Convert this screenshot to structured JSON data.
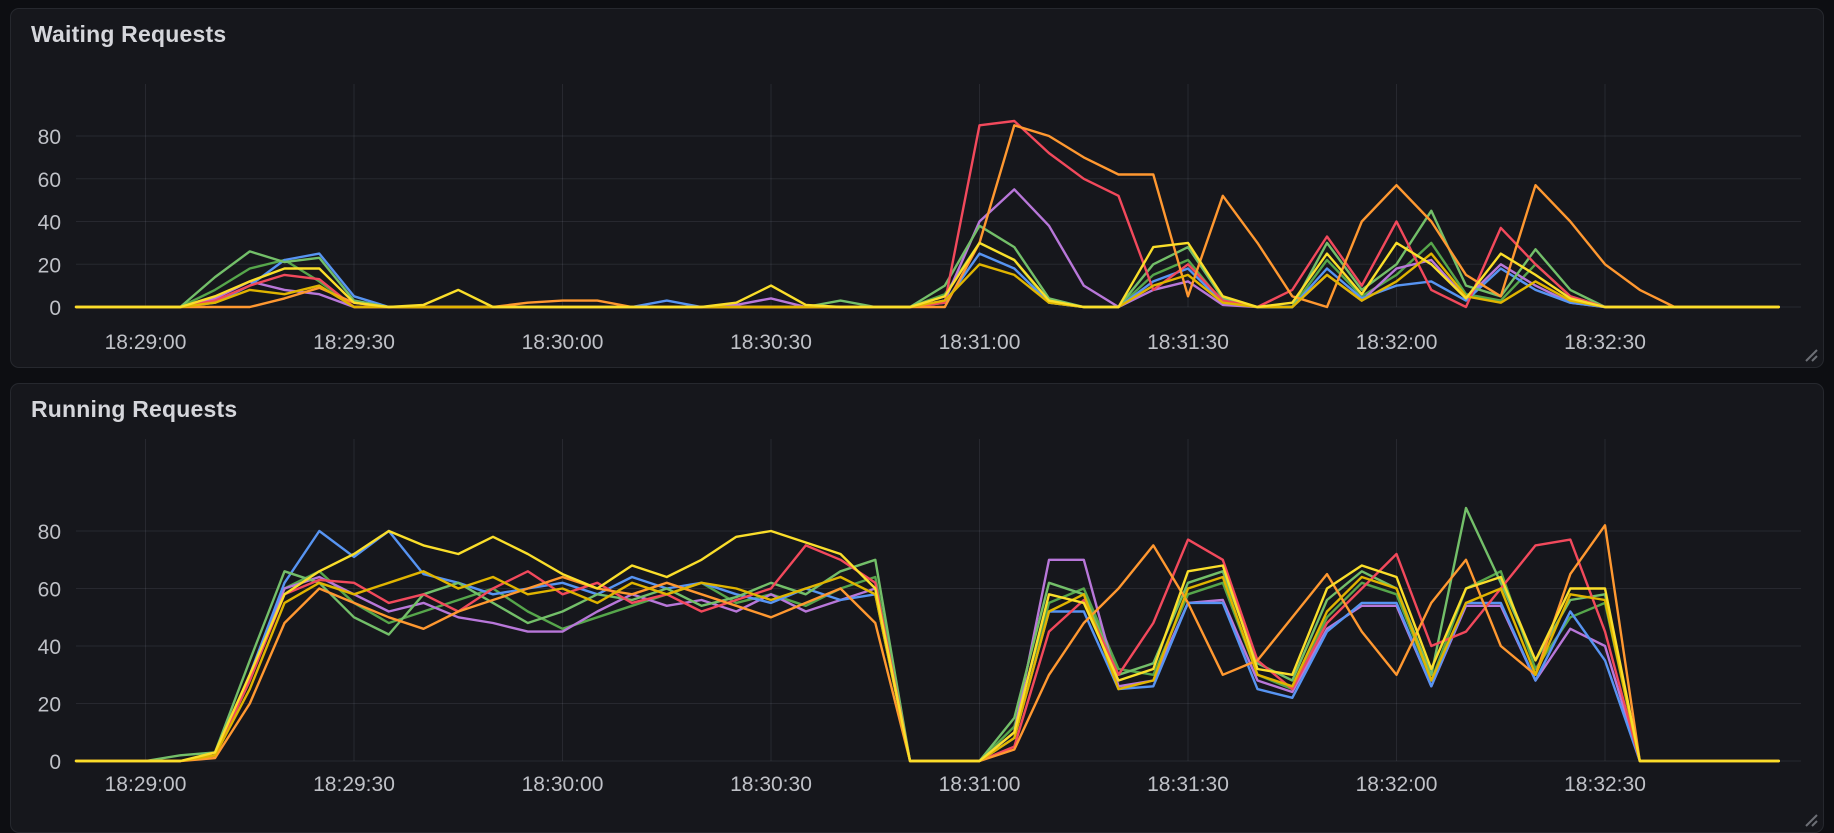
{
  "panels": [
    {
      "title": "Waiting Requests"
    },
    {
      "title": "Running Requests"
    }
  ],
  "theme": {
    "page_background": "#0d0e12",
    "panel_background": "#16171c",
    "panel_border": "#26282e",
    "title_color": "#d5d6db",
    "axis_text_color": "#bfc1c7",
    "grid_color": "rgba(216,222,240,0.09)"
  },
  "chart_data": [
    {
      "type": "line",
      "title": "Waiting Requests",
      "xlabel": "",
      "ylabel": "",
      "legend": "none",
      "grid": true,
      "ylim": [
        0,
        104
      ],
      "y_ticks": [
        0,
        20,
        40,
        60,
        80
      ],
      "x_step_seconds": 5,
      "x_ticks": [
        {
          "label": "18:29:00",
          "t": 10
        },
        {
          "label": "18:29:30",
          "t": 40
        },
        {
          "label": "18:30:00",
          "t": 70
        },
        {
          "label": "18:30:30",
          "t": 100
        },
        {
          "label": "18:31:00",
          "t": 130
        },
        {
          "label": "18:31:30",
          "t": 160
        },
        {
          "label": "18:32:00",
          "t": 190
        },
        {
          "label": "18:32:30",
          "t": 220
        }
      ],
      "series": [
        {
          "name": "dark-green",
          "color": "#56A64B",
          "values": [
            0,
            0,
            0,
            0,
            8,
            18,
            22,
            12,
            0,
            0,
            0,
            0,
            0,
            0,
            0,
            0,
            0,
            0,
            0,
            0,
            0,
            0,
            0,
            0,
            0,
            6,
            30,
            22,
            2,
            0,
            0,
            15,
            22,
            2,
            0,
            0,
            22,
            5,
            15,
            30,
            6,
            3,
            20,
            5,
            0,
            0,
            0,
            0,
            0,
            0
          ]
        },
        {
          "name": "purple",
          "color": "#B877D9",
          "values": [
            0,
            0,
            0,
            0,
            4,
            12,
            8,
            6,
            0,
            0,
            0,
            0,
            0,
            0,
            0,
            0,
            0,
            0,
            0,
            1,
            4,
            0,
            0,
            0,
            0,
            3,
            40,
            55,
            38,
            10,
            0,
            8,
            12,
            1,
            0,
            0,
            15,
            3,
            18,
            22,
            4,
            20,
            10,
            2,
            0,
            0,
            0,
            0,
            0,
            0
          ]
        },
        {
          "name": "blue",
          "color": "#5794F2",
          "values": [
            0,
            0,
            0,
            0,
            2,
            10,
            22,
            25,
            5,
            0,
            0,
            0,
            0,
            0,
            0,
            0,
            0,
            3,
            0,
            0,
            0,
            0,
            0,
            0,
            0,
            2,
            25,
            18,
            2,
            0,
            0,
            12,
            18,
            2,
            0,
            0,
            18,
            4,
            10,
            12,
            3,
            18,
            8,
            2,
            0,
            0,
            0,
            0,
            0,
            0
          ]
        },
        {
          "name": "green",
          "color": "#73BF69",
          "values": [
            0,
            0,
            0,
            0,
            14,
            26,
            21,
            23,
            3,
            0,
            0,
            0,
            0,
            0,
            0,
            0,
            0,
            0,
            0,
            0,
            0,
            0,
            3,
            0,
            0,
            10,
            38,
            28,
            4,
            0,
            0,
            20,
            28,
            4,
            0,
            0,
            30,
            8,
            20,
            45,
            10,
            5,
            27,
            8,
            0,
            0,
            0,
            0,
            0,
            0
          ]
        },
        {
          "name": "red",
          "color": "#F2495C",
          "values": [
            0,
            0,
            0,
            0,
            3,
            10,
            15,
            13,
            0,
            0,
            0,
            0,
            0,
            0,
            0,
            0,
            0,
            0,
            0,
            0,
            0,
            0,
            0,
            0,
            0,
            2,
            85,
            87,
            72,
            60,
            52,
            8,
            20,
            3,
            0,
            8,
            33,
            10,
            40,
            8,
            0,
            37,
            20,
            5,
            0,
            0,
            0,
            0,
            0,
            0
          ]
        },
        {
          "name": "orange",
          "color": "#FF9830",
          "values": [
            0,
            0,
            0,
            0,
            0,
            0,
            4,
            9,
            2,
            0,
            0,
            0,
            0,
            2,
            3,
            3,
            0,
            0,
            0,
            0,
            0,
            0,
            0,
            0,
            0,
            0,
            30,
            85,
            80,
            70,
            62,
            62,
            5,
            52,
            30,
            5,
            0,
            40,
            57,
            40,
            15,
            5,
            57,
            40,
            20,
            8,
            0,
            0,
            0,
            0
          ]
        },
        {
          "name": "dark-yellow",
          "color": "#E0B400",
          "values": [
            0,
            0,
            0,
            0,
            2,
            8,
            6,
            10,
            0,
            0,
            0,
            0,
            0,
            0,
            0,
            0,
            0,
            0,
            0,
            0,
            0,
            0,
            0,
            0,
            0,
            3,
            20,
            15,
            2,
            0,
            0,
            10,
            15,
            2,
            0,
            0,
            15,
            3,
            12,
            25,
            5,
            2,
            12,
            3,
            0,
            0,
            0,
            0,
            0,
            0
          ]
        },
        {
          "name": "yellow",
          "color": "#FADE2A",
          "values": [
            0,
            0,
            0,
            0,
            5,
            12,
            18,
            18,
            2,
            0,
            1,
            8,
            0,
            0,
            0,
            0,
            0,
            0,
            0,
            2,
            10,
            1,
            0,
            0,
            0,
            5,
            30,
            22,
            3,
            0,
            0,
            28,
            30,
            5,
            0,
            2,
            25,
            6,
            30,
            20,
            4,
            25,
            15,
            4,
            0,
            0,
            0,
            0,
            0,
            0
          ]
        }
      ]
    },
    {
      "type": "line",
      "title": "Running Requests",
      "xlabel": "",
      "ylabel": "",
      "legend": "none",
      "grid": true,
      "ylim": [
        0,
        112
      ],
      "y_ticks": [
        0,
        20,
        40,
        60,
        80
      ],
      "x_step_seconds": 5,
      "x_ticks": [
        {
          "label": "18:29:00",
          "t": 10
        },
        {
          "label": "18:29:30",
          "t": 40
        },
        {
          "label": "18:30:00",
          "t": 70
        },
        {
          "label": "18:30:30",
          "t": 100
        },
        {
          "label": "18:31:00",
          "t": 130
        },
        {
          "label": "18:31:30",
          "t": 160
        },
        {
          "label": "18:32:00",
          "t": 190
        },
        {
          "label": "18:32:30",
          "t": 220
        }
      ],
      "series": [
        {
          "name": "dark-green",
          "color": "#56A64B",
          "values": [
            0,
            0,
            0,
            0,
            2,
            28,
            60,
            66,
            55,
            48,
            52,
            56,
            60,
            52,
            46,
            50,
            54,
            58,
            62,
            55,
            58,
            54,
            60,
            64,
            0,
            0,
            0,
            12,
            55,
            60,
            32,
            30,
            58,
            62,
            30,
            25,
            50,
            62,
            58,
            28,
            60,
            66,
            32,
            50,
            55,
            0,
            0,
            0,
            0,
            0
          ]
        },
        {
          "name": "purple",
          "color": "#B877D9",
          "values": [
            0,
            0,
            0,
            0,
            2,
            30,
            60,
            64,
            58,
            52,
            55,
            50,
            48,
            45,
            45,
            52,
            58,
            54,
            56,
            52,
            58,
            52,
            56,
            60,
            0,
            0,
            0,
            10,
            70,
            70,
            26,
            28,
            55,
            56,
            28,
            24,
            46,
            54,
            54,
            26,
            54,
            54,
            28,
            46,
            40,
            0,
            0,
            0,
            0,
            0
          ]
        },
        {
          "name": "blue",
          "color": "#5794F2",
          "values": [
            0,
            0,
            0,
            0,
            2,
            30,
            62,
            80,
            71,
            80,
            65,
            62,
            58,
            60,
            62,
            58,
            64,
            60,
            62,
            58,
            55,
            60,
            56,
            58,
            0,
            0,
            0,
            8,
            52,
            52,
            25,
            26,
            55,
            55,
            25,
            22,
            45,
            55,
            55,
            26,
            55,
            55,
            28,
            52,
            35,
            0,
            0,
            0,
            0,
            0
          ]
        },
        {
          "name": "green",
          "color": "#73BF69",
          "values": [
            0,
            0,
            0,
            2,
            3,
            35,
            66,
            62,
            50,
            44,
            58,
            62,
            55,
            48,
            52,
            58,
            56,
            60,
            54,
            57,
            62,
            58,
            66,
            70,
            0,
            0,
            0,
            15,
            62,
            58,
            30,
            34,
            62,
            66,
            34,
            28,
            56,
            66,
            60,
            30,
            88,
            62,
            35,
            56,
            58,
            0,
            0,
            0,
            0,
            0
          ]
        },
        {
          "name": "red",
          "color": "#F2495C",
          "values": [
            0,
            0,
            0,
            0,
            2,
            28,
            58,
            63,
            62,
            55,
            58,
            52,
            60,
            66,
            58,
            62,
            55,
            58,
            52,
            56,
            60,
            75,
            70,
            62,
            0,
            0,
            0,
            5,
            45,
            56,
            30,
            48,
            77,
            70,
            35,
            25,
            48,
            60,
            72,
            40,
            45,
            60,
            75,
            77,
            45,
            0,
            0,
            0,
            0,
            0
          ]
        },
        {
          "name": "orange",
          "color": "#FF9830",
          "values": [
            0,
            0,
            0,
            0,
            1,
            20,
            48,
            60,
            55,
            50,
            46,
            52,
            56,
            60,
            64,
            60,
            58,
            62,
            58,
            54,
            50,
            55,
            60,
            48,
            0,
            0,
            0,
            4,
            30,
            48,
            60,
            75,
            55,
            30,
            35,
            50,
            65,
            45,
            30,
            55,
            70,
            40,
            30,
            65,
            82,
            0,
            0,
            0,
            0,
            0
          ]
        },
        {
          "name": "dark-yellow",
          "color": "#E0B400",
          "values": [
            0,
            0,
            0,
            0,
            2,
            25,
            55,
            62,
            58,
            62,
            66,
            60,
            64,
            58,
            60,
            55,
            62,
            58,
            62,
            60,
            56,
            60,
            64,
            58,
            0,
            0,
            0,
            8,
            52,
            58,
            25,
            28,
            60,
            64,
            30,
            26,
            52,
            64,
            60,
            28,
            55,
            60,
            30,
            58,
            56,
            0,
            0,
            0,
            0,
            0
          ]
        },
        {
          "name": "yellow",
          "color": "#FADE2A",
          "values": [
            0,
            0,
            0,
            0,
            3,
            30,
            58,
            66,
            72,
            80,
            75,
            72,
            78,
            72,
            65,
            60,
            68,
            64,
            70,
            78,
            80,
            76,
            72,
            60,
            0,
            0,
            0,
            10,
            58,
            55,
            28,
            32,
            66,
            68,
            32,
            30,
            60,
            68,
            64,
            32,
            60,
            64,
            35,
            60,
            60,
            0,
            0,
            0,
            0,
            0
          ]
        }
      ]
    }
  ]
}
